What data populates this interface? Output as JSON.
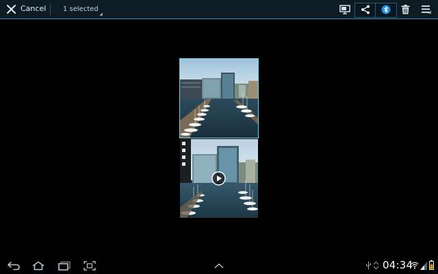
{
  "action_bar": {
    "cancel_label": "Cancel",
    "selection_label": "1 selected",
    "accent_color": "#2f8fb4"
  },
  "actions": {
    "icons": [
      "screen-mirroring-icon",
      "share-icon",
      "bluetooth-icon",
      "delete-icon",
      "menu-icon"
    ]
  },
  "gallery": {
    "items": [
      {
        "type": "photo",
        "selected": true
      },
      {
        "type": "video",
        "selected": false
      }
    ],
    "selection_color": "#6fd1ee"
  },
  "system_bar": {
    "time": "04:34",
    "nav_icons": [
      "back-icon",
      "home-icon",
      "recent-apps-icon",
      "screenshot-icon"
    ],
    "status_icons": [
      "usb-icon",
      "sync-icon",
      "wifi-icon",
      "signal-icon",
      "battery-icon"
    ]
  }
}
